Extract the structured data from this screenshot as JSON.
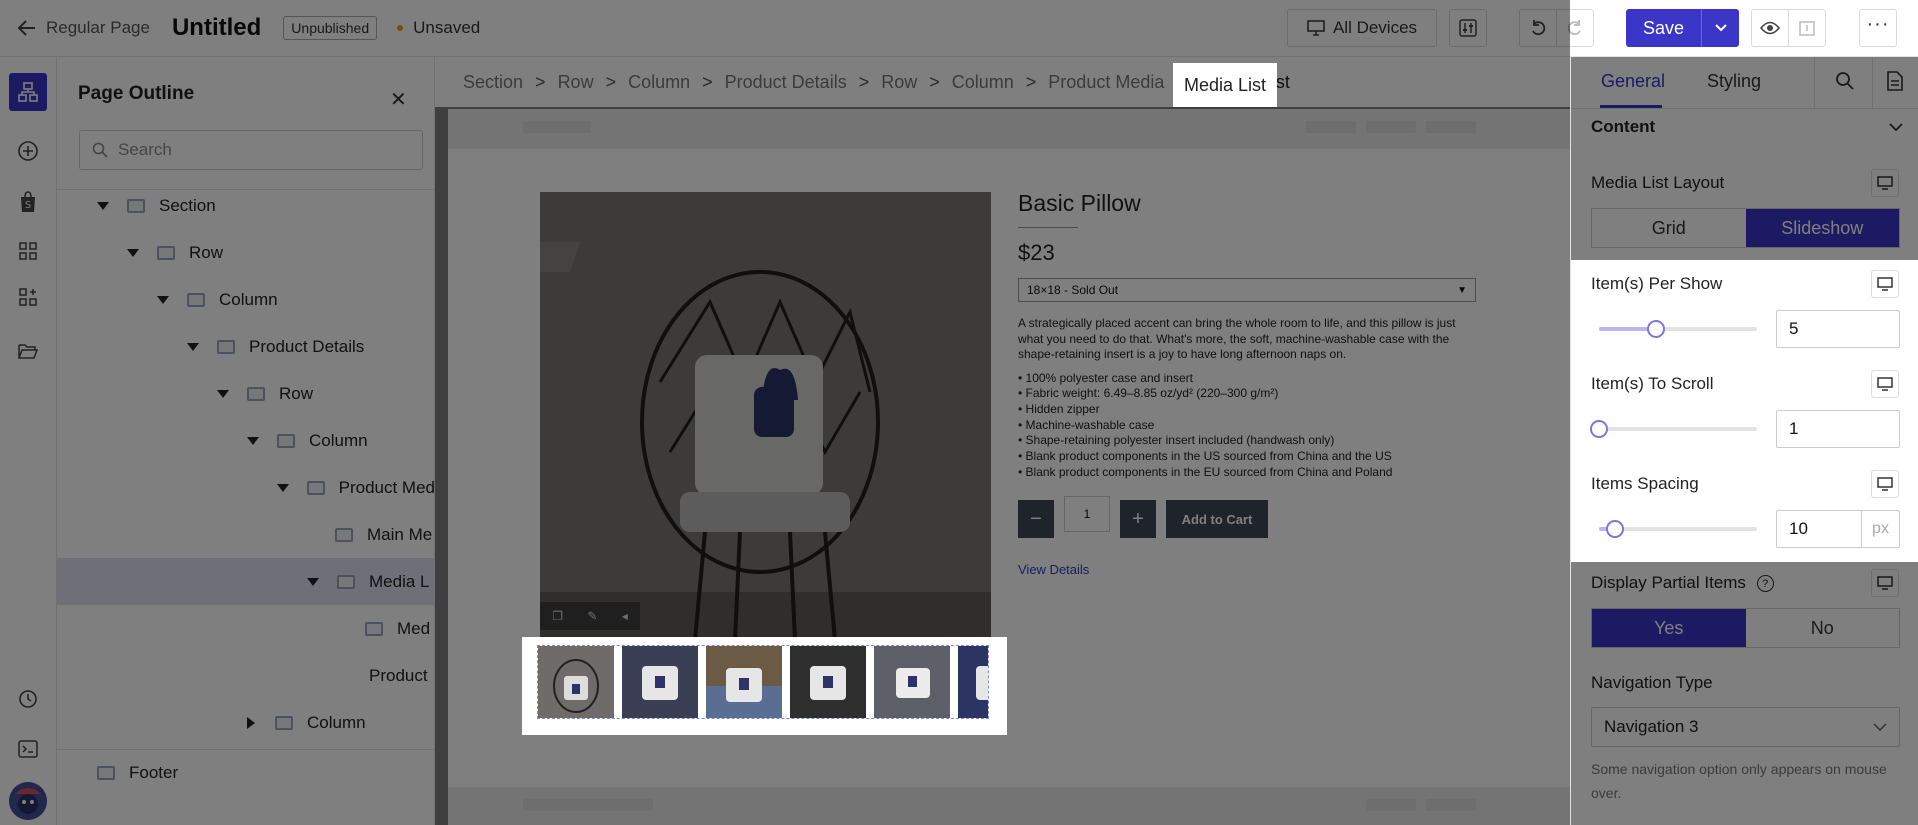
{
  "topbar": {
    "back_label": "Regular Page",
    "page_title": "Untitled",
    "status_badge": "Unpublished",
    "unsaved_label": "Unsaved",
    "devices_label": "All Devices",
    "save_label": "Save"
  },
  "outline": {
    "title": "Page Outline",
    "search_placeholder": "Search",
    "items": [
      {
        "label": "Section"
      },
      {
        "label": "Row"
      },
      {
        "label": "Column"
      },
      {
        "label": "Product Details"
      },
      {
        "label": "Row"
      },
      {
        "label": "Column"
      },
      {
        "label": "Product Med"
      },
      {
        "label": "Main Me"
      },
      {
        "label": "Media L"
      },
      {
        "label": "Med"
      },
      {
        "label": "Product"
      },
      {
        "label": "Column"
      },
      {
        "label": "Footer"
      }
    ]
  },
  "breadcrumb": [
    "Section",
    "Row",
    "Column",
    "Product Details",
    "Row",
    "Column",
    "Product Media",
    "Media List"
  ],
  "product": {
    "title": "Basic Pillow",
    "price": "$23",
    "variant": "18×18 - Sold Out",
    "description": "A strategically placed accent can bring the whole room to life, and this pillow is just what you need to do that. What's more, the soft, machine-washable case with the shape-retaining insert is a joy to have long afternoon naps on.",
    "bullets": [
      "• 100% polyester case and insert",
      "• Fabric weight: 6.49–8.85 oz/yd² (220–300 g/m²)",
      "• Hidden zipper",
      "• Machine-washable case",
      "• Shape-retaining polyester insert included (handwash only)",
      "• Blank product components in the US sourced from China and the US",
      "• Blank product components in the EU sourced from China and Poland"
    ],
    "quantity": "1",
    "minus": "−",
    "plus": "+",
    "add_to_cart": "Add to Cart",
    "view_details": "View Details"
  },
  "rpanel": {
    "tab_general": "General",
    "tab_styling": "Styling",
    "content_heading": "Content",
    "layout_label": "Media List Layout",
    "layout_options": [
      "Grid",
      "Slideshow"
    ],
    "layout_selected": "Slideshow",
    "per_show_label": "Item(s) Per Show",
    "per_show_value": "5",
    "per_show_slider": 0.36,
    "to_scroll_label": "Item(s) To Scroll",
    "to_scroll_value": "1",
    "to_scroll_slider": 0.0,
    "spacing_label": "Items Spacing",
    "spacing_value": "10",
    "spacing_unit": "px",
    "spacing_slider": 0.1,
    "partial_label": "Display Partial Items",
    "partial_options": [
      "Yes",
      "No"
    ],
    "partial_selected": "Yes",
    "nav_label": "Navigation Type",
    "nav_value": "Navigation 3",
    "nav_help": "Some navigation option only appears on mouse over."
  },
  "colors": {
    "accent": "#3b35c8",
    "unsaved_dot": "#e8a317",
    "button_dark": "#3f4654"
  }
}
